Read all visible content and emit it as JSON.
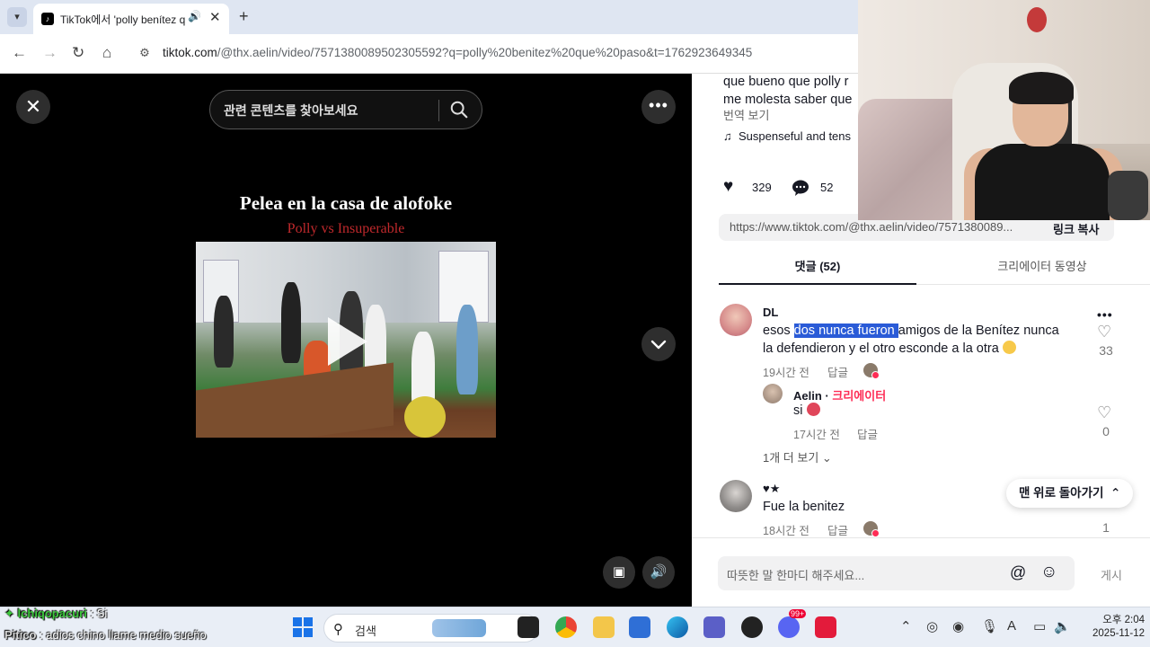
{
  "browser": {
    "tab_title": "TikTok에서 'polly benítez q",
    "url_host": "tiktok.com",
    "url_path": "/@thx.aelin/video/7571380089502305592?q=polly%20benitez%20que%20paso&t=1762923649345"
  },
  "video": {
    "search_placeholder": "관련 콘텐츠를 찾아보세요",
    "title": "Pelea en la casa de alofoke",
    "subtitle": "Polly vs Insuperable"
  },
  "panel": {
    "description_line1": "que bueno que polly r",
    "description_line2": "me molesta saber que",
    "translate_label": "번역 보기",
    "music": "Suspenseful and tens",
    "likes": "329",
    "comments": "52",
    "share_url": "https://www.tiktok.com/@thx.aelin/video/7571380089...",
    "copy_link_label": "링크 복사",
    "tab_comments": "댓글 (52)",
    "tab_creator_videos": "크리에이터 동영상",
    "back_to_top": "맨 위로 돌아가기",
    "comment_placeholder": "따뜻한 말 한마디 해주세요...",
    "post_label": "게시"
  },
  "comments": [
    {
      "user": "DL",
      "text_before": "esos ",
      "text_selected": "dos nunca fueron ",
      "text_after": "amigos de la Benítez nunca",
      "text_line2": "la defendieron y el otro esconde a la otra",
      "time": "19시간 전",
      "reply_label": "답글",
      "likes": "33"
    },
    {
      "user": "♥★",
      "text": "Fue la benitez",
      "time": "18시간 전",
      "reply_label": "답글",
      "likes": "1"
    }
  ],
  "reply": {
    "user": "Aelin",
    "separator": " · ",
    "creator_badge": "크리에이터",
    "text": "si",
    "time": "17시간 전",
    "reply_label": "답글",
    "likes": "0"
  },
  "more_replies": "1개 더 보기",
  "taskbar": {
    "search_label": "검색",
    "time": "오후 2:04",
    "date": "2025-11-12",
    "badge": "99+"
  },
  "chat_overlay": [
    {
      "name": "lchiqopacuri",
      "message": " : Si"
    },
    {
      "name": "Pitico",
      "message": " : adios chino llame medio sueño"
    }
  ],
  "colors": {
    "tiktok_red": "#fe2c55",
    "selection_blue": "#2a5bd7",
    "taskbar_bg": "#e9eef6"
  }
}
